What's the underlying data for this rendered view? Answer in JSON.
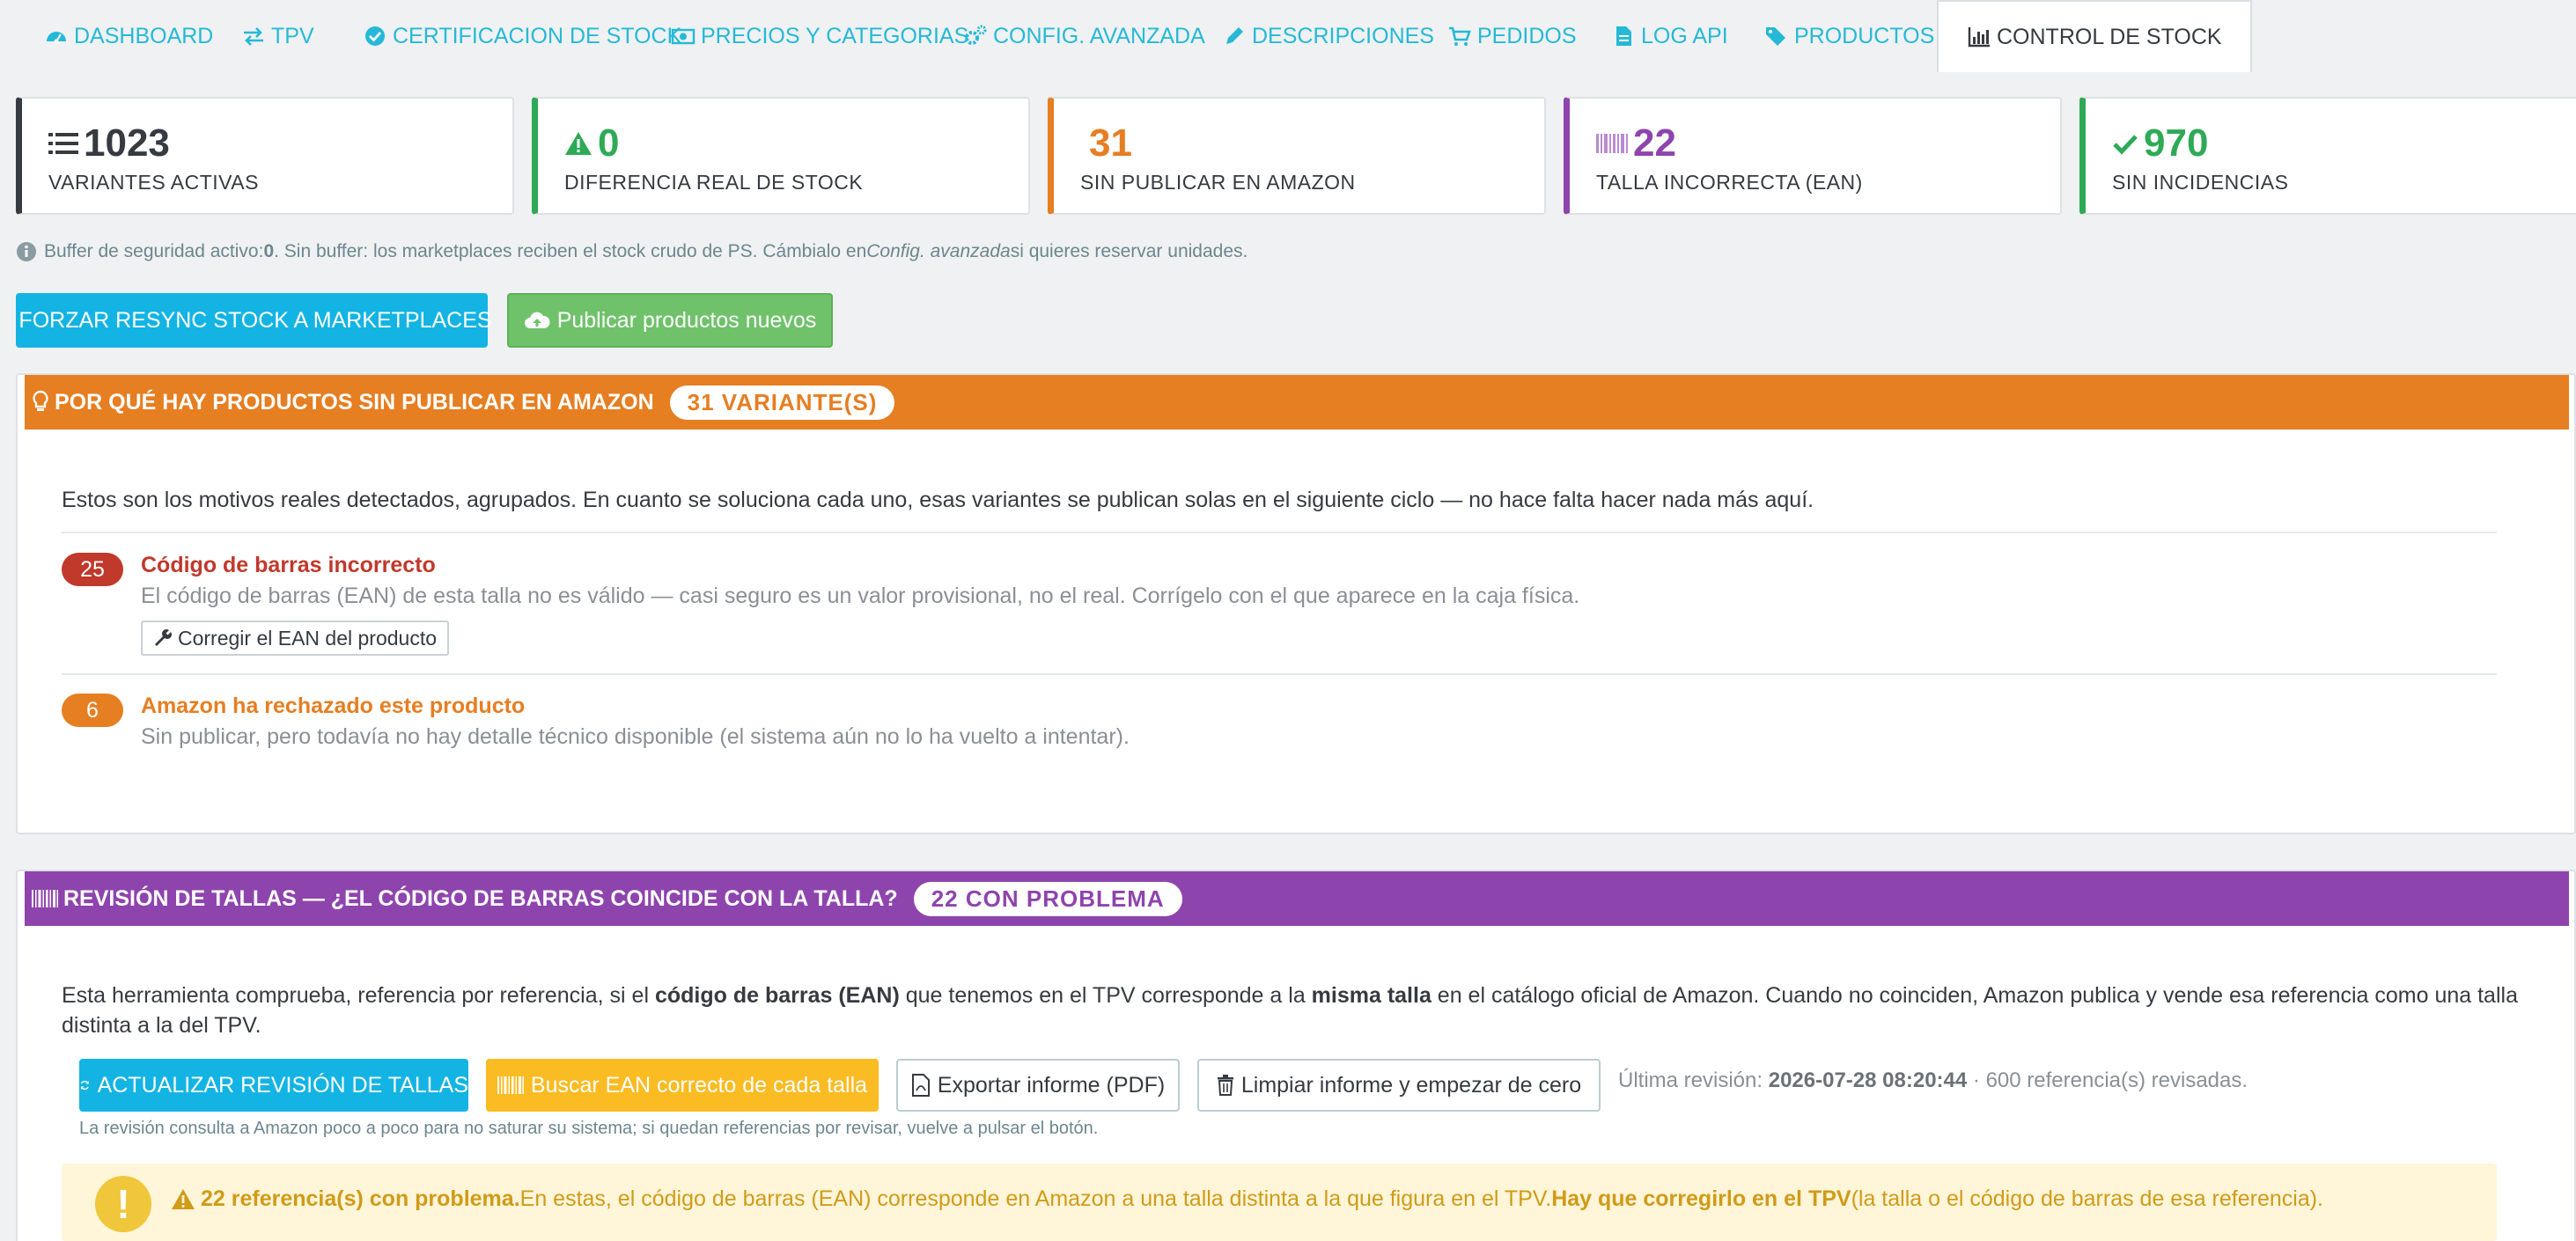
{
  "tabs": [
    {
      "label": "DASHBOARD",
      "icon": "dashboard-icon"
    },
    {
      "label": "TPV",
      "icon": "exchange-icon"
    },
    {
      "label": "CERTIFICACION DE STOCK",
      "icon": "check-circle-icon"
    },
    {
      "label": "PRECIOS Y CATEGORIAS",
      "icon": "money-icon"
    },
    {
      "label": "CONFIG. AVANZADA",
      "icon": "gears-icon"
    },
    {
      "label": "DESCRIPCIONES",
      "icon": "pencil-icon"
    },
    {
      "label": "PEDIDOS",
      "icon": "cart-icon"
    },
    {
      "label": "LOG API",
      "icon": "file-icon"
    },
    {
      "label": "PRODUCTOS",
      "icon": "tags-icon"
    },
    {
      "label": "CONTROL DE STOCK",
      "icon": "bar-chart-icon",
      "active": true
    }
  ],
  "kpis": [
    {
      "value": "1023",
      "label": "VARIANTES ACTIVAS",
      "color": "#363a41",
      "icon": "list-icon"
    },
    {
      "value": "0",
      "label": "DIFERENCIA REAL DE STOCK",
      "color": "#2eaa57",
      "icon": "warning-icon"
    },
    {
      "value": "31",
      "label": "SIN PUBLICAR EN AMAZON",
      "color": "#e67e22",
      "icon": ""
    },
    {
      "value": "22",
      "label": "TALLA INCORRECTA (EAN)",
      "color": "#8e44ad",
      "icon": "barcode-icon"
    },
    {
      "value": "970",
      "label": "SIN INCIDENCIAS",
      "color": "#2eaa57",
      "icon": "check-icon"
    }
  ],
  "buffer_note": {
    "a": "Buffer de seguridad activo: ",
    "b": "0",
    "c": ". Sin buffer: los marketplaces reciben el stock crudo de PS. Cámbialo en ",
    "d": "Config. avanzada",
    "e": " si quieres reservar unidades."
  },
  "actions": {
    "resync": "FORZAR RESYNC STOCK A MARKETPLACES",
    "publish": "Publicar productos nuevos"
  },
  "unpublished_panel": {
    "title": "POR QUÉ HAY PRODUCTOS SIN PUBLICAR EN AMAZON",
    "pill": "31 VARIANTE(S)",
    "color": "#e67e22",
    "intro": "Estos son los motivos reales detectados, agrupados. En cuanto se soluciona cada uno, esas variantes se publican solas en el siguiente ciclo — no hace falta hacer nada más aquí.",
    "reasons": [
      {
        "count": "25",
        "title": "Código de barras incorrecto",
        "desc": "El código de barras (EAN) de esta talla no es válido — casi seguro es un valor provisional, no el real. Corrígelo con el que aparece en la caja física.",
        "action": "Corregir el EAN del producto",
        "color": "#c0392b"
      },
      {
        "count": "6",
        "title": "Amazon ha rechazado este producto",
        "desc": "Sin publicar, pero todavía no hay detalle técnico disponible (el sistema aún no lo ha vuelto a intentar).",
        "color": "#e67e22"
      }
    ]
  },
  "size_panel": {
    "title": "REVISIÓN DE TALLAS — ¿EL CÓDIGO DE BARRAS COINCIDE CON LA TALLA?",
    "pill": "22 CON PROBLEMA",
    "color": "#8e44ad",
    "intro_a": "Esta herramienta comprueba, referencia por referencia, si el ",
    "intro_b": "código de barras (EAN)",
    "intro_c": " que tenemos en el TPV corresponde a la ",
    "intro_d": "misma talla",
    "intro_e": " en el catálogo oficial de Amazon. Cuando no coinciden, Amazon publica y vende esa referencia como una talla distinta a la del TPV.",
    "buttons": {
      "refresh": "ACTUALIZAR REVISIÓN DE TALLAS",
      "search": "Buscar EAN correcto de cada talla",
      "export": "Exportar informe (PDF)",
      "clear": "Limpiar informe y empezar de cero"
    },
    "last_review_label": "Última revisión: ",
    "last_review_date": "2026-07-28 08:20:44",
    "last_review_count": " · 600 referencia(s) revisadas.",
    "hint": "La revisión consulta a Amazon poco a poco para no saturar su sistema; si quedan referencias por revisar, vuelve a pulsar el botón.",
    "warning_a": "22 referencia(s) con problema.",
    "warning_b": " En estas, el código de barras (EAN) corresponde en Amazon a una talla distinta a la que figura en el TPV. ",
    "warning_c": "Hay que corregirlo en el TPV",
    "warning_d": " (la talla o el código de barras de esa referencia)."
  }
}
